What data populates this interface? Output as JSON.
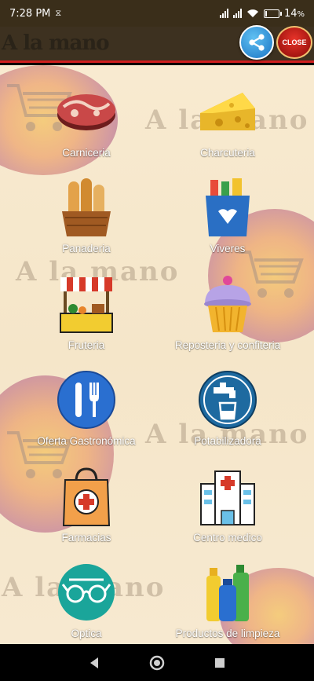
{
  "status": {
    "time": "7:28 PM",
    "battery": "14",
    "battery_unit": "%",
    "battery_level": 0.14
  },
  "header": {
    "title": "A la mano",
    "close_label": "CLOSE"
  },
  "watermark_text": "A la mano",
  "categories": [
    {
      "label": "Carniceria"
    },
    {
      "label": "Charcuteria"
    },
    {
      "label": "Panaderia"
    },
    {
      "label": "Viveres"
    },
    {
      "label": "Fruteria"
    },
    {
      "label": "Reposteria y confiteria"
    },
    {
      "label": "Oferta Gastronómica"
    },
    {
      "label": "Potabilizadora"
    },
    {
      "label": "Farmacias"
    },
    {
      "label": "Centro medico"
    },
    {
      "label": "Optica"
    },
    {
      "label": "Productos de limpieza"
    }
  ],
  "colors": {
    "header_bg": "#3d3120",
    "accent_red": "#d01f1f",
    "share_blue": "#1a74c4",
    "main_bg": "#f5e6c9"
  }
}
